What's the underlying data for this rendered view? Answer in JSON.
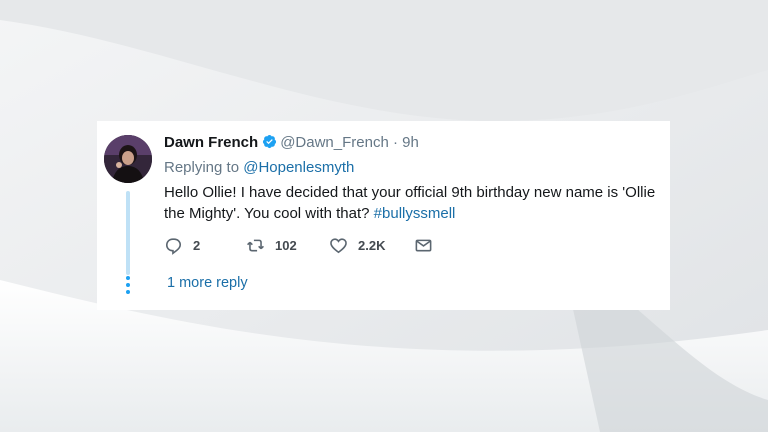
{
  "tweet": {
    "author_name": "Dawn French",
    "author_handle": "@Dawn_French",
    "separator": "·",
    "time": "9h",
    "replying_prefix": "Replying to",
    "replying_handle": "@Hopenlesmyth",
    "text": "Hello Ollie! I have decided that your official 9th birthday new name is 'Ollie the Mighty'. You cool with that?",
    "hashtag": "#bullyssmell",
    "replies": "2",
    "retweets": "102",
    "likes": "2.2K",
    "more_replies": "1 more reply",
    "verified": true
  },
  "icons": [
    "reply-icon",
    "retweet-icon",
    "like-icon",
    "message-icon",
    "verified-badge-icon"
  ],
  "colors": {
    "link": "#1b6fa8",
    "verified": "#1da1f2",
    "thread_line": "#bfe1f6"
  }
}
